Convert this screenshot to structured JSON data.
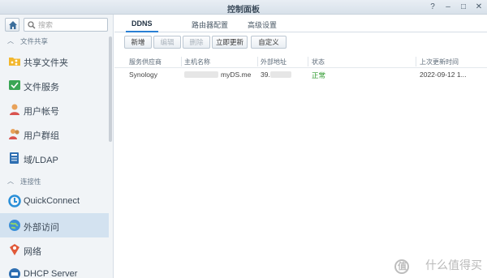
{
  "window": {
    "title": "控制面板"
  },
  "controls": {
    "help": "?",
    "minimize": "–",
    "maximize": "□",
    "close": "✕"
  },
  "sidebar": {
    "search_placeholder": "搜索",
    "sections": [
      {
        "label": "文件共享",
        "items": [
          "共享文件夹",
          "文件服务",
          "用户帐号",
          "用户群组",
          "域/LDAP"
        ]
      },
      {
        "label": "连接性",
        "items": [
          "QuickConnect",
          "外部访问",
          "网络",
          "DHCP Server"
        ]
      }
    ],
    "active_item": "外部访问"
  },
  "tabs": [
    "DDNS",
    "路由器配置",
    "高级设置"
  ],
  "active_tab": "DDNS",
  "toolbar": {
    "add": "新增",
    "edit": "编辑",
    "delete": "删除",
    "update_now": "立即更新",
    "customize": "自定义"
  },
  "table": {
    "columns": [
      "服务供应商",
      "主机名称",
      "外部地址",
      "状态",
      "上次更新时间"
    ],
    "rows": [
      {
        "provider": "Synology",
        "hostname": "myDS.me",
        "address": "39.",
        "status": "正常",
        "updated": "2022-09-12 1..."
      }
    ]
  },
  "watermark": {
    "text": "什么值得买",
    "icon_text": "值"
  },
  "colors": {
    "accent": "#2a7fd4",
    "status_ok": "#2d9a2d",
    "active_bg": "#d3e2f0"
  }
}
